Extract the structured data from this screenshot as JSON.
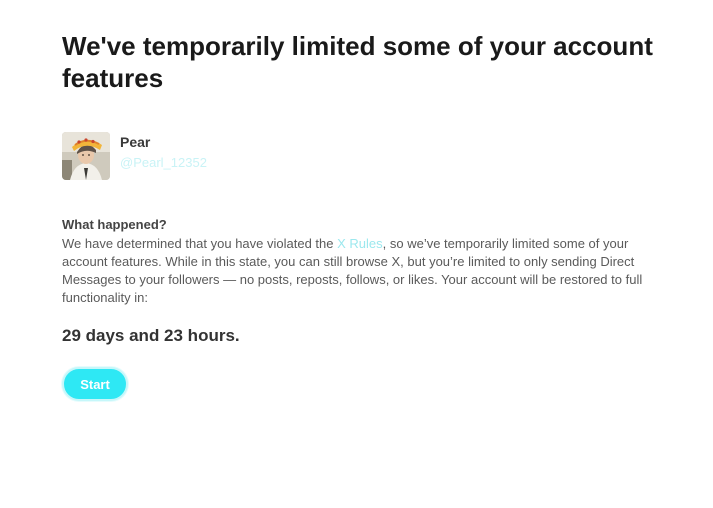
{
  "header": {
    "title": "We've temporarily limited some of your account features"
  },
  "account": {
    "name": "Pear",
    "handle": "@Pearl_12352"
  },
  "notice": {
    "heading": "What happened?",
    "body_before_link": "We have determined that you have violated the ",
    "link_label": "X Rules",
    "body_after_link": ", so we’ve temporarily limited some of your account features. While in this state, you can still browse X, but you’re limited to only sending Direct Messages to your followers — no posts, reposts, follows, or likes. Your account will be restored to full functionality in:"
  },
  "countdown": {
    "text": "29 days and 23 hours."
  },
  "actions": {
    "start_label": "Start"
  },
  "colors": {
    "accent": "#2ee8f4",
    "link": "#9ce8ee",
    "title": "#1a1a1a",
    "body_text": "#5a5a5a"
  },
  "icons": {
    "avatar": "profile-photo"
  }
}
